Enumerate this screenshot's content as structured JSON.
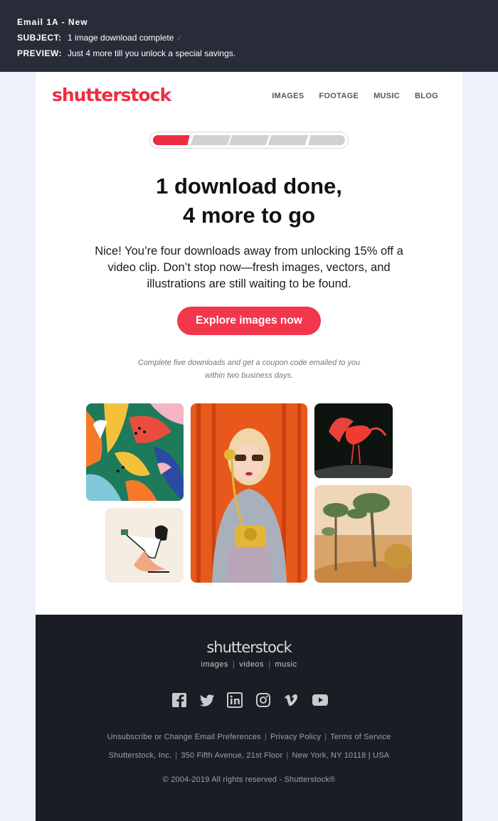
{
  "meta": {
    "title": "Email 1A - New",
    "subject_key": "SUBJECT:",
    "subject_value": "1 image download complete",
    "subject_check": "✓",
    "preview_key": "PREVIEW:",
    "preview_value": "Just 4 more till you unlock a special savings."
  },
  "header": {
    "logo": "shutterstock",
    "nav": [
      "IMAGES",
      "FOOTAGE",
      "MUSIC",
      "BLOG"
    ]
  },
  "progress": {
    "completed": 1,
    "total": 5
  },
  "main": {
    "headline_1": "1 download done,",
    "headline_2": "4 more to go",
    "body_1": "Nice! You’re four downloads away from unlocking 15% off a",
    "body_2": "video clip. Don’t stop now—fresh images, vectors, and",
    "body_3": "illustrations are still waiting to be found.",
    "cta": "Explore images now",
    "fineprint_1": "Complete five downloads and get a coupon code emailed to you",
    "fineprint_2": "within two business days."
  },
  "footer": {
    "logo": "shutterstock",
    "categories": [
      "images",
      "videos",
      "music"
    ],
    "social_icons": [
      "facebook-icon",
      "twitter-icon",
      "linkedin-icon",
      "instagram-icon",
      "vimeo-icon",
      "youtube-icon"
    ],
    "links": [
      "Unsubscribe or Change Email Preferences",
      "Privacy Policy",
      "Terms of Service"
    ],
    "address": [
      "Shutterstock, Inc.",
      "350 Fifth Avenue, 21st Floor",
      "New York, NY 10118 | USA"
    ],
    "copyright": "© 2004-2019 All rights reserved - Shutterstock®"
  },
  "colors": {
    "brand": "#ee2d42",
    "meta_bg": "#282c38",
    "footer_bg": "#1b1d24",
    "page_bg": "#eef0fc"
  }
}
